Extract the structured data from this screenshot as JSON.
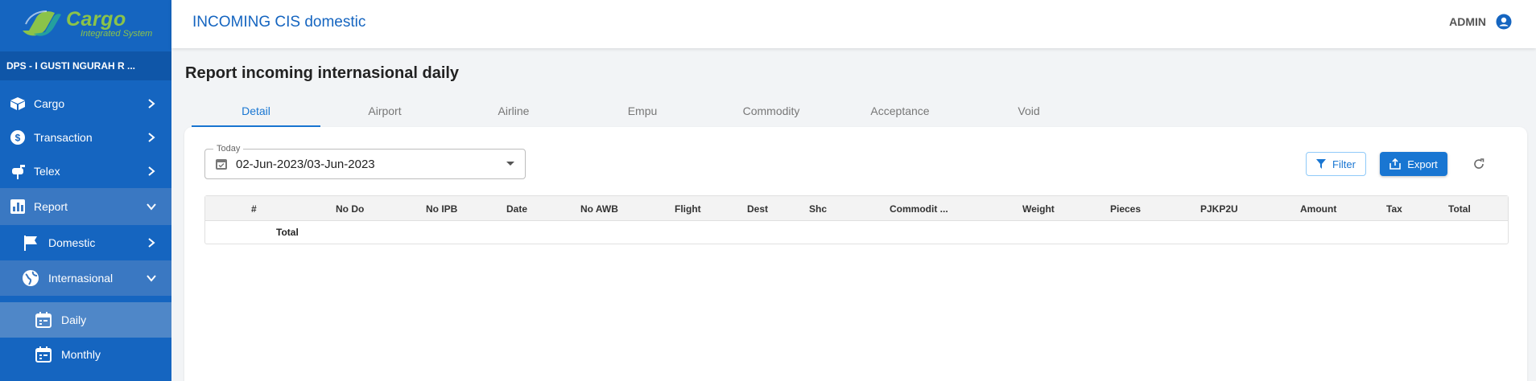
{
  "brand": {
    "title": "Cargo",
    "subtitle": "Integrated System",
    "color": "#8bc34a"
  },
  "sidebar": {
    "station": "DPS - I GUSTI NGURAH R ...",
    "items": [
      {
        "label": "Cargo",
        "icon": "box-icon"
      },
      {
        "label": "Transaction",
        "icon": "dollar-icon"
      },
      {
        "label": "Telex",
        "icon": "mailbox-icon"
      },
      {
        "label": "Report",
        "icon": "chart-icon"
      },
      {
        "label": "Domestic",
        "icon": "flag-icon"
      },
      {
        "label": "Internasional",
        "icon": "globe-icon"
      },
      {
        "label": "Daily",
        "icon": "calendar-icon"
      },
      {
        "label": "Monthly",
        "icon": "calendar-icon"
      }
    ]
  },
  "header": {
    "app_title": "INCOMING CIS domestic",
    "user": "ADMIN"
  },
  "main": {
    "page_title": "Report incoming internasional daily",
    "tabs": [
      "Detail",
      "Airport",
      "Airline",
      "Empu",
      "Commodity",
      "Acceptance",
      "Void"
    ],
    "date_filter": {
      "label": "Today",
      "value": "02-Jun-2023/03-Jun-2023"
    },
    "filter_label": "Filter",
    "export_label": "Export",
    "table": {
      "columns": [
        "#",
        "No Do",
        "No IPB",
        "Date",
        "No AWB",
        "Flight",
        "Dest",
        "Shc",
        "Commodit ...",
        "Weight",
        "Pieces",
        "PJKP2U",
        "Amount",
        "Tax",
        "Total"
      ],
      "total_label": "Total"
    }
  },
  "colors": {
    "sidebar": "#1565c0",
    "accent": "#1976d2"
  }
}
